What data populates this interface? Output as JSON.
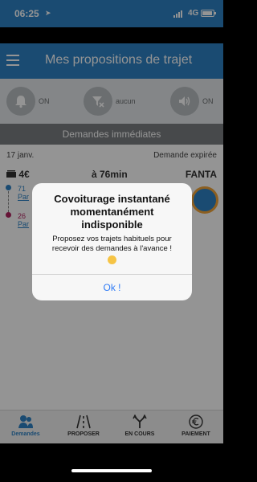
{
  "status_bar": {
    "time": "06:25",
    "location_arrow": "➤",
    "network": "4G",
    "battery_icon": "battery-icon"
  },
  "header": {
    "title": "Mes propositions de trajet",
    "menu_icon": "hamburger-menu-icon"
  },
  "filters": [
    {
      "icon": "bell-icon",
      "label": "ON"
    },
    {
      "icon": "filter-off-icon",
      "label": "aucun"
    },
    {
      "icon": "speaker-icon",
      "label": "ON"
    }
  ],
  "section": {
    "title": "Demandes immédiates"
  },
  "request_card": {
    "date": "17 janv.",
    "status": "Demande expirée",
    "price": "4€",
    "eta": "à 76min",
    "driver": "FANTA",
    "route_start_prefix": "71",
    "route_start_city": "Par",
    "route_end_prefix": "26",
    "route_end_city": "Par"
  },
  "tabbar": {
    "tabs": [
      {
        "label": "Demandes",
        "icon": "users-icon",
        "active": true
      },
      {
        "label": "PROPOSER",
        "icon": "road-icon",
        "active": false
      },
      {
        "label": "EN COURS",
        "icon": "route-fork-icon",
        "active": false
      },
      {
        "label": "PAIEMENT",
        "icon": "euro-icon",
        "active": false
      }
    ]
  },
  "dialog": {
    "title": "Covoiturage instantané momentanément indisponible",
    "message": "Proposez vos trajets habituels pour recevoir des demandes à l'avance !",
    "emoji": "worried-face-icon",
    "button": "Ok !"
  },
  "colors": {
    "brand": "#2e82c4",
    "accent_pink": "#b0235f",
    "dialog_button": "#2f7bf6"
  }
}
